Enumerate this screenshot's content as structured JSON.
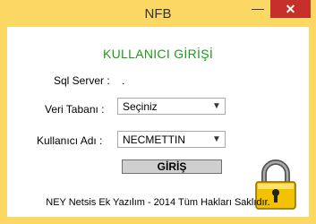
{
  "window": {
    "title": "NFB",
    "min_glyph": "—",
    "close_glyph": "✕"
  },
  "form": {
    "heading": "KULLANICI GİRİŞİ",
    "sql_server_label": "Sql Server :",
    "sql_server_value": ".",
    "database_label": "Veri Tabanı :",
    "database_selected": "Seçiniz",
    "user_label": "Kullanıcı Adı :",
    "user_selected": "NECMETTIN",
    "login_button": "GİRİŞ"
  },
  "footer": "NEY Netsis Ek Yazılım - 2014 Tüm Hakları Saklıdır.",
  "icons": {
    "dropdown": "chevron-down-icon",
    "lock": "padlock-icon"
  },
  "colors": {
    "frame": "#fbd863",
    "heading": "#1e9a1e",
    "close": "#c7302a",
    "lock": "#f2c200"
  }
}
